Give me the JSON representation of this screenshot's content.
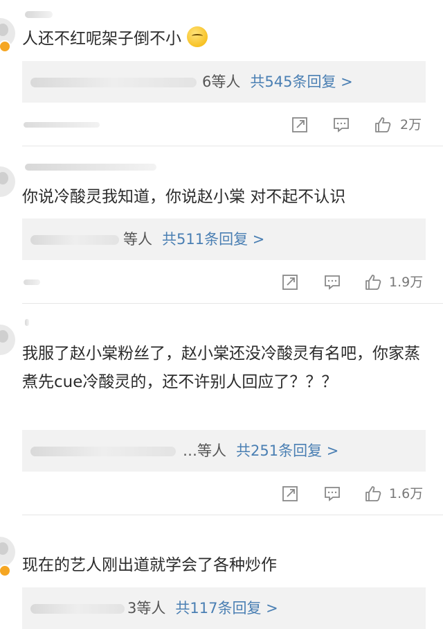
{
  "comments": [
    {
      "text": "人还不红呢架子倒不小",
      "emoji": "sweat-smile-emoji",
      "reply_suffix": "6等人",
      "reply_more": "共545条回复 >",
      "likes": "2万"
    },
    {
      "text": "你说冷酸灵我知道，你说赵小棠 对不起不认识",
      "reply_suffix": "等人",
      "reply_more": "共511条回复 >",
      "likes": "1.9万"
    },
    {
      "text": "我服了赵小棠粉丝了，赵小棠还没冷酸灵有名吧，你家蒸煮先cue冷酸灵的，还不许别人回应了？？？",
      "reply_suffix": "…等人",
      "reply_more": "共251条回复 >",
      "likes": "1.6万"
    },
    {
      "text": "现在的艺人刚出道就学会了各种炒作",
      "reply_suffix": "3等人",
      "reply_more": "共117条回复 >"
    }
  ],
  "icons": [
    "share-icon",
    "comment-icon",
    "like-icon"
  ],
  "colors": {
    "link": "#4a7fb3",
    "reply_bg": "#f2f2f2",
    "badge": "#f5a623"
  }
}
